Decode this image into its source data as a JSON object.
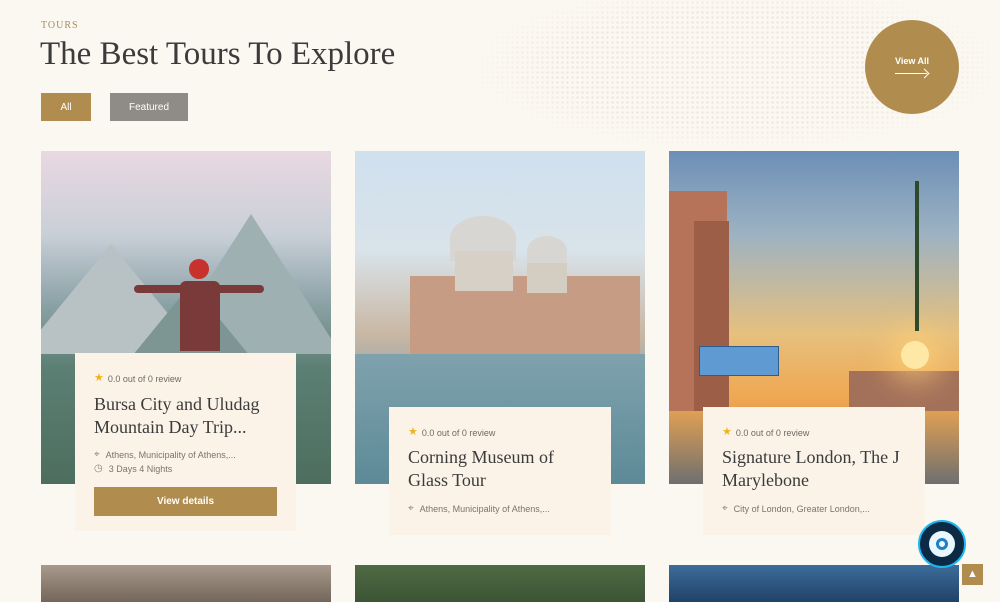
{
  "section": {
    "eyebrow": "TOURS",
    "title": "The Best Tours To Explore"
  },
  "filters": [
    {
      "label": "All",
      "active": true
    },
    {
      "label": "Featured",
      "active": false
    }
  ],
  "view_all": {
    "label": "View All"
  },
  "cards": [
    {
      "rating_text": "0.0 out of 0 review",
      "title": "Bursa City and Uludag Mountain Day Trip...",
      "location": "Athens, Municipality of Athens,...",
      "duration": "3 Days 4 Nights",
      "button": "View details"
    },
    {
      "rating_text": "0.0 out of 0 review",
      "title": "Corning Museum of Glass Tour",
      "location": "Athens, Municipality of Athens,..."
    },
    {
      "rating_text": "0.0 out of 0 review",
      "title": "Signature London, The J Marylebone",
      "location": "City of London, Greater London,..."
    }
  ],
  "icons": {
    "star": "star-icon",
    "location": "location-pin-icon",
    "clock": "clock-icon",
    "arrow": "arrow-right-icon",
    "chat": "chat-widget-icon",
    "scroll_top": "chevron-up-icon"
  },
  "colors": {
    "accent": "#b08d4f",
    "secondary_button": "#8f8b87",
    "background": "#fbf7f1",
    "card_panel": "#fbf3e8",
    "star": "#f2b21b"
  }
}
